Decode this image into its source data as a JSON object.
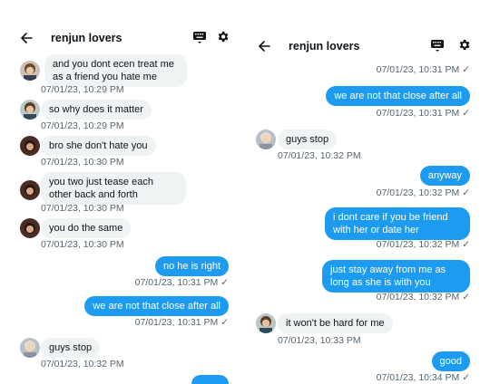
{
  "left": {
    "title": "renjun lovers",
    "messages": [
      {
        "text": "and you dont ecen treat me as a friend you hate me",
        "time": "07/01/23, 10:29 PM"
      },
      {
        "text": "so why does it matter",
        "time": "07/01/23, 10:29 PM"
      },
      {
        "text": "bro she don't hate you",
        "time": "07/01/23, 10:30 PM"
      },
      {
        "text": "you two just tease each other back and forth",
        "time": "07/01/23, 10:30 PM"
      },
      {
        "text": "you do the same",
        "time": "07/01/23, 10:30 PM"
      },
      {
        "text": "no he is right",
        "time": "07/01/23, 10:31 PM ✓"
      },
      {
        "text": "we are not that close after all",
        "time": "07/01/23, 10:31 PM ✓"
      },
      {
        "text": "guys stop",
        "time": "07/01/23, 10:32 PM"
      }
    ]
  },
  "right": {
    "title": "renjun lovers",
    "top_time": "07/01/23, 10:31 PM ✓",
    "messages": [
      {
        "text": "we are not that close after all",
        "time": "07/01/23, 10:31 PM ✓"
      },
      {
        "text": "guys stop",
        "time": "07/01/23, 10:32 PM"
      },
      {
        "text": "anyway",
        "time": "07/01/23, 10:32 PM ✓"
      },
      {
        "text": "i dont care if you be friend with her or date her",
        "time": "07/01/23, 10:32 PM ✓"
      },
      {
        "text": "just stay away from me as long as she is with you",
        "time": "07/01/23, 10:32 PM ✓"
      },
      {
        "text": "it won't be hard for me",
        "time": "07/01/23, 10:33 PM"
      },
      {
        "text": "good",
        "time": "07/01/23, 10:34 PM ✓"
      }
    ]
  },
  "icons": {
    "back": "arrow-left-icon",
    "keyboard": "keyboard-icon",
    "settings": "gear-icon"
  },
  "colors": {
    "outgoing_bubble": "#1d9bf0",
    "incoming_bubble": "#eff3f4",
    "timestamp": "#536471",
    "text": "#0f1419"
  }
}
